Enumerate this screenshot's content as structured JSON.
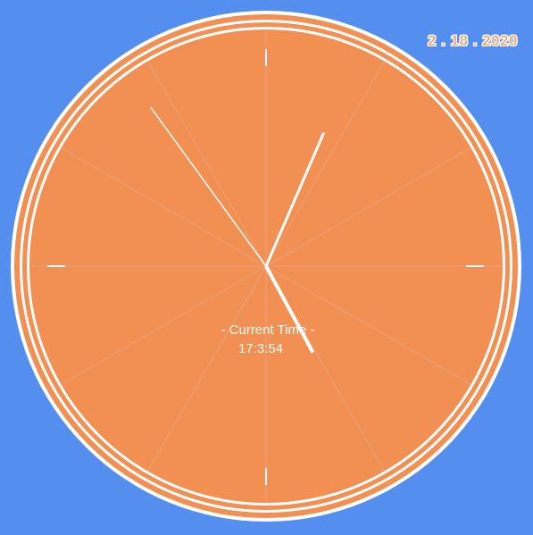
{
  "date": "2 . 18 . 2020",
  "clock": {
    "caption": "- Current Time -",
    "time": "17:3:54",
    "hands": {
      "hour": {
        "hours": 17,
        "minutes": 3
      },
      "minute": {
        "minutes": 3,
        "seconds": 54
      },
      "second": {
        "seconds": 54
      }
    }
  },
  "colors": {
    "background": "#548ff0",
    "face": "#f28f52",
    "rim": "#ffffff",
    "ticks": "#ffffff",
    "radial_lines": "#e8a27a"
  }
}
